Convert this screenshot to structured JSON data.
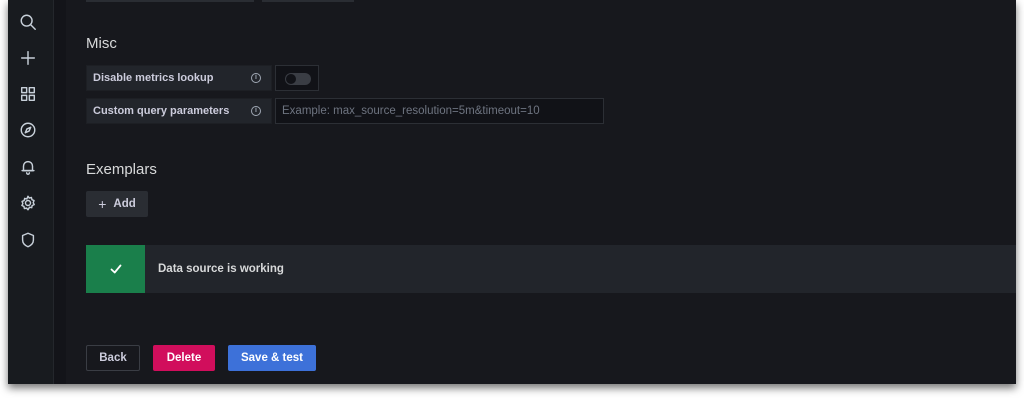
{
  "sidebar": {
    "icons": [
      "search-icon",
      "plus-icon",
      "dashboards-icon",
      "explore-icon",
      "alerting-icon",
      "settings-icon",
      "shield-icon"
    ]
  },
  "misc": {
    "heading": "Misc",
    "disable_metrics_lookup": {
      "label": "Disable metrics lookup",
      "enabled": false
    },
    "custom_query_parameters": {
      "label": "Custom query parameters",
      "value": "",
      "placeholder": "Example: max_source_resolution=5m&timeout=10"
    }
  },
  "exemplars": {
    "heading": "Exemplars",
    "add_label": "Add",
    "add_symbol": "+"
  },
  "alert": {
    "text": "Data source is working",
    "status": "success",
    "color": "#1a7f4b"
  },
  "actions": {
    "back_label": "Back",
    "delete_label": "Delete",
    "save_label": "Save & test"
  },
  "colors": {
    "background": "#111217",
    "delete": "#d10e5c",
    "primary": "#3d71d9",
    "success": "#1a7f4b"
  }
}
